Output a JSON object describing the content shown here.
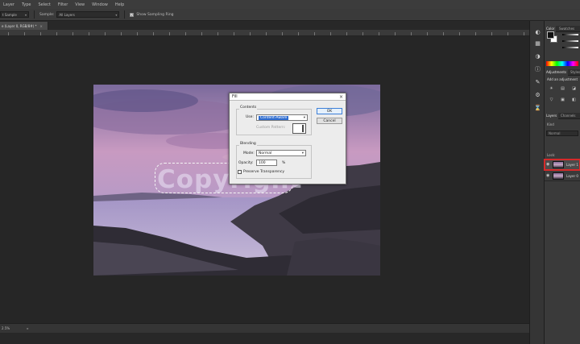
{
  "menu": [
    "Layer",
    "Type",
    "Select",
    "Filter",
    "View",
    "Window",
    "Help"
  ],
  "options_bar": {
    "first_select": "t Sample",
    "sample_label": "Sample:",
    "sample_value": "All Layers",
    "show_sampling_ring": "Show Sampling Ring"
  },
  "document_tab": {
    "title": "e (Layer 0, RGB/8#) *",
    "close": "×"
  },
  "fill_dialog": {
    "title": "Fill",
    "close": "×",
    "contents_label": "Contents",
    "use_label": "Use:",
    "use_value": "Content-Aware",
    "custom_pattern_label": "Custom Pattern:",
    "blending_label": "Blending",
    "mode_label": "Mode:",
    "mode_value": "Normal",
    "opacity_label": "Opacity:",
    "opacity_value": "100",
    "opacity_unit": "%",
    "preserve_transparency": "Preserve Transparency",
    "ok_label": "OK",
    "cancel_label": "Cancel"
  },
  "watermark": "Copyright",
  "status_bar": {
    "zoom": "2.5%",
    "arrow": "▸"
  },
  "panels": {
    "color_tabs": [
      "Color",
      "Swatches"
    ],
    "adjustment_tabs": [
      "Adjustments",
      "Styles"
    ],
    "adjustments_title": "Add an adjustment",
    "layers_tabs": [
      "Layers",
      "Channels"
    ],
    "kind_label": "Kind",
    "normal_label": "Normal",
    "lock_label": "Lock:",
    "layers": [
      {
        "name": "Layer 1",
        "selected": true
      },
      {
        "name": "Layer 0",
        "selected": false
      }
    ]
  },
  "colors": {
    "accent": "#2f6ccf",
    "selected_outline": "#d62a2a"
  }
}
